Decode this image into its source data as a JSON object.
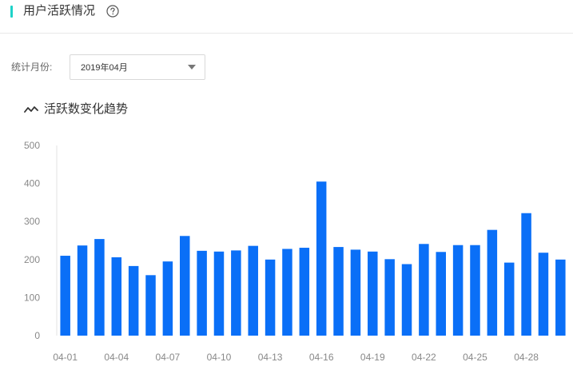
{
  "header": {
    "title": "用户活跃情况",
    "accent_color": "#1ed2c8",
    "help_icon": "question-circle-icon"
  },
  "filter": {
    "label": "统计月份:",
    "selected_value": "2019年04月",
    "select_icon": "caret-down-icon"
  },
  "chart_section": {
    "title": "活跃数变化趋势",
    "icon": "trend-line-icon"
  },
  "chart_data": {
    "type": "bar",
    "bar_color": "#0a6ff7",
    "ylim": [
      0,
      500
    ],
    "y_ticks": [
      "0",
      "100",
      "200",
      "300",
      "400",
      "500"
    ],
    "categories": [
      "04-01",
      "04-02",
      "04-03",
      "04-04",
      "04-05",
      "04-06",
      "04-07",
      "04-08",
      "04-09",
      "04-10",
      "04-11",
      "04-12",
      "04-13",
      "04-14",
      "04-15",
      "04-16",
      "04-17",
      "04-18",
      "04-19",
      "04-20",
      "04-21",
      "04-22",
      "04-23",
      "04-24",
      "04-25",
      "04-26",
      "04-27",
      "04-28",
      "04-29",
      "04-30"
    ],
    "x_tick_labels": [
      "04-01",
      "04-04",
      "04-07",
      "04-10",
      "04-13",
      "04-16",
      "04-19",
      "04-22",
      "04-25",
      "04-28"
    ],
    "values": [
      210,
      237,
      254,
      206,
      183,
      159,
      195,
      262,
      223,
      221,
      224,
      236,
      200,
      228,
      231,
      405,
      233,
      226,
      221,
      201,
      188,
      241,
      220,
      238,
      238,
      278,
      192,
      322,
      218,
      200
    ]
  }
}
